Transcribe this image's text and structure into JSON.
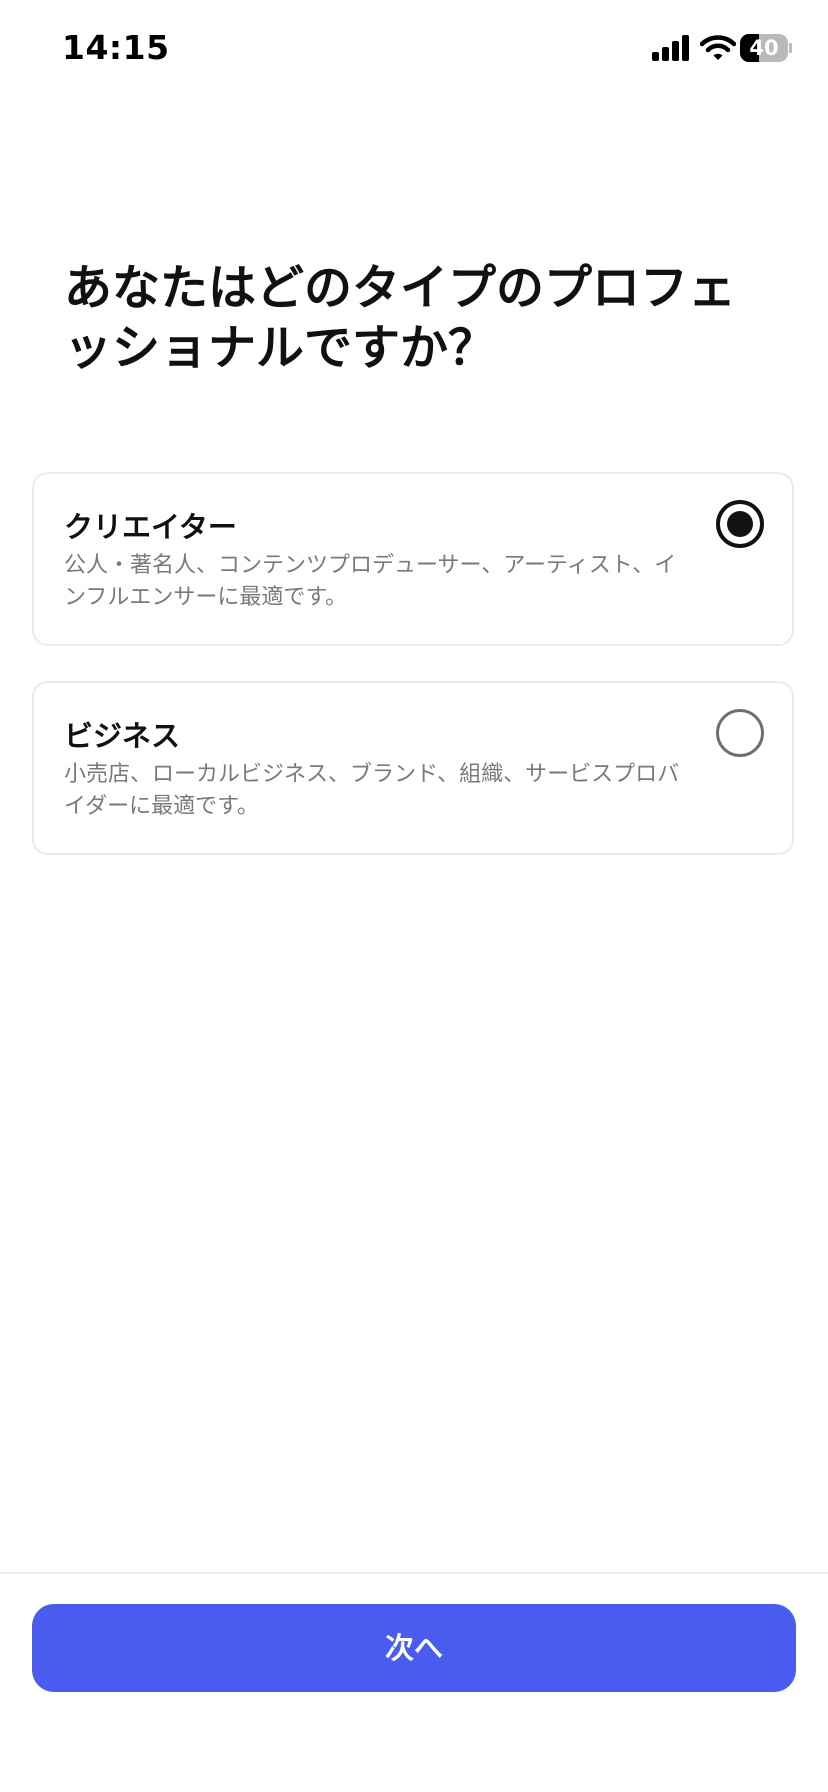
{
  "status_bar": {
    "time": "14:15",
    "battery_level": "40",
    "battery_fraction": 0.4
  },
  "title": "あなたはどのタイプのプロフェッショナルですか？",
  "options": [
    {
      "title": "クリエイター",
      "description": "公人・著名人、コンテンツプロデューサー、アーティスト、インフルエンサーに最適です。",
      "selected": true
    },
    {
      "title": "ビジネス",
      "description": "小売店、ローカルビジネス、ブランド、組織、サービスプロバイダーに最適です。",
      "selected": false
    }
  ],
  "footer": {
    "next_label": "次へ"
  },
  "colors": {
    "primary_button": "#4a5cf0",
    "text_primary": "#111111",
    "text_secondary": "#7a7a7a"
  },
  "icons": {
    "signal": "cellular-signal-icon",
    "wifi": "wifi-icon",
    "battery": "battery-icon"
  }
}
